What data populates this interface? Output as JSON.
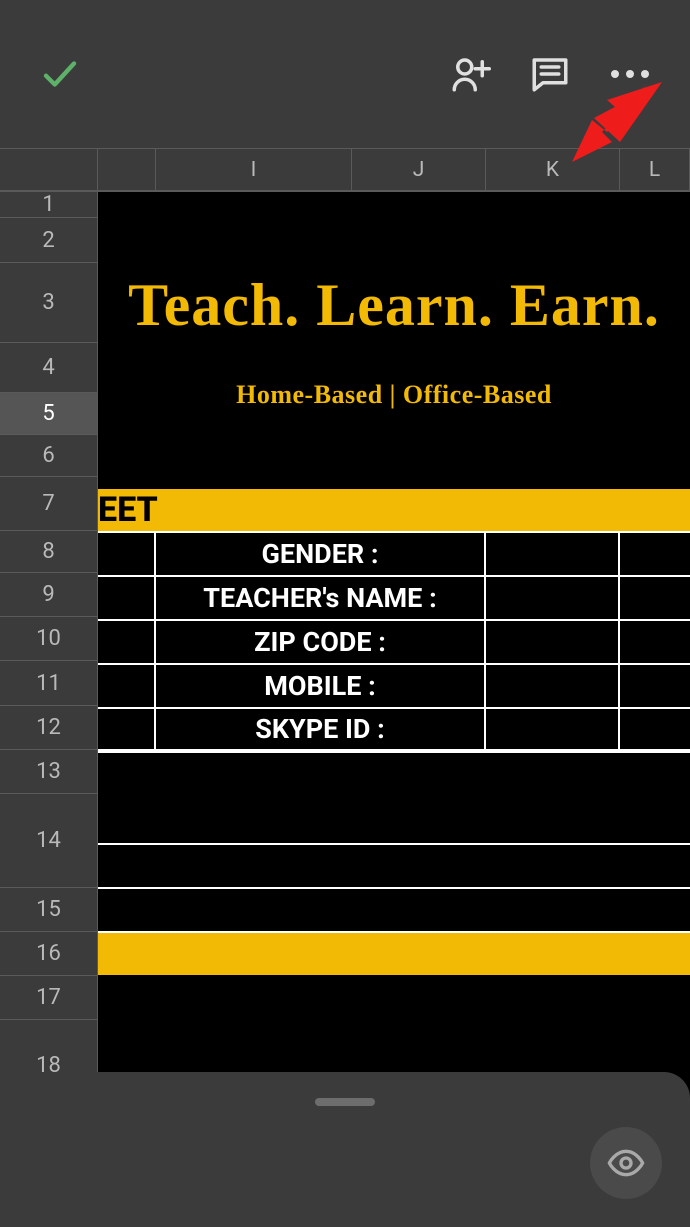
{
  "columns": {
    "h": "",
    "i": "I",
    "j": "J",
    "k": "K",
    "l": "L"
  },
  "rows": [
    "1",
    "2",
    "3",
    "4",
    "5",
    "6",
    "7",
    "8",
    "9",
    "10",
    "11",
    "12",
    "13",
    "14",
    "15",
    "16",
    "17",
    "18"
  ],
  "selected_row": "5",
  "banner": {
    "headline": "Teach. Learn. Earn.",
    "subline": "Home-Based    |   Office-Based"
  },
  "partial_title": "EET",
  "form": {
    "r9": "GENDER :",
    "r10": "TEACHER's NAME :",
    "r11": "ZIP CODE :",
    "r12": "MOBILE :",
    "r13": "SKYPE ID :"
  },
  "icons": {
    "check": "check",
    "share": "person-add",
    "comment": "comment",
    "more": "more",
    "eye": "eye"
  }
}
